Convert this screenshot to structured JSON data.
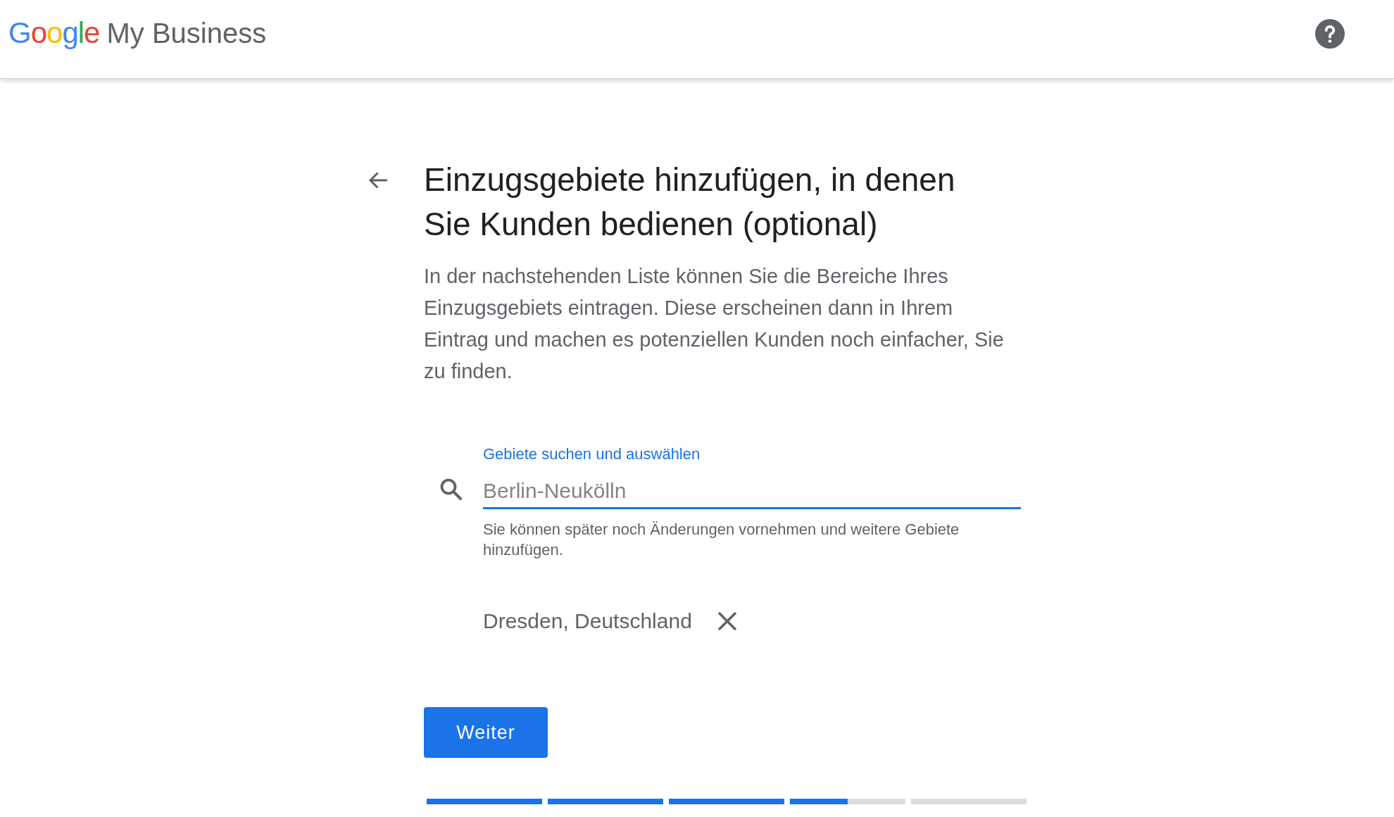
{
  "header": {
    "logo_google": "Google",
    "logo_product": "My Business"
  },
  "title": "Einzugsgebiete hinzufügen, in denen Sie Kunden bedienen (optional)",
  "description": "In der nachstehenden Liste können Sie die Bereiche Ihres Einzugsgebiets eintragen. Diese erscheinen dann in Ihrem Eintrag und machen es potenziellen Kunden noch einfacher, Sie zu finden.",
  "search": {
    "label": "Gebiete suchen und auswählen",
    "placeholder": "Berlin-Neukölln",
    "helper": "Sie können später noch Änderungen vornehmen und weitere Gebiete hinzufügen."
  },
  "areas": [
    {
      "label": "Dresden, Deutschland"
    }
  ],
  "button": "Weiter",
  "progress": [
    {
      "complete": true
    },
    {
      "complete": true
    },
    {
      "complete": true
    },
    {
      "complete": false,
      "level": 0.5
    },
    {
      "complete": false
    }
  ]
}
